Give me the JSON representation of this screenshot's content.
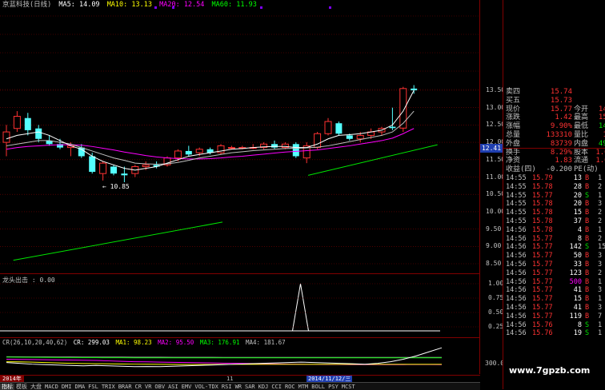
{
  "header": {
    "name": "京蓝科技(日线)",
    "ma5": "MA5: 14.09",
    "ma10": "MA10: 13.13",
    "ma20": "MA20: 12.54",
    "ma60": "MA60: 11.93"
  },
  "colors": {
    "up": "#ff3232",
    "down": "#54ffff",
    "ma5": "#ffffff",
    "ma10": "#ffff00",
    "ma20": "#ff00ff",
    "ma60": "#00ff00",
    "grid": "#800000",
    "green": "#00e600"
  },
  "main_axis": {
    "ticks": [
      "13.50",
      "13.00",
      "12.50",
      "12.00",
      "11.50",
      "11.00",
      "10.50",
      "10.00",
      "9.50",
      "9.00",
      "8.50"
    ],
    "current": "12.41",
    "low_label": "10.85"
  },
  "indicator1": {
    "title": "龙头出击 : 0.00",
    "ticks": [
      "1.00",
      "0.75",
      "0.50",
      "0.25"
    ]
  },
  "indicator2": {
    "title": "CR(26,10,20,40,62)",
    "cr": "CR: 299.03",
    "ma1": "MA1: 98.23",
    "ma2": "MA2: 95.50",
    "ma3": "MA3: 176.91",
    "ma4": "MA4: 181.67",
    "tick": "300.0"
  },
  "timeline": {
    "left": "2014年",
    "mid": "11",
    "date": "2014/11/12/三"
  },
  "tabs": [
    "指标",
    "模板",
    "大盘",
    "MACD",
    "DMI",
    "DMA",
    "FSL",
    "TRIX",
    "BRAR",
    "CR",
    "VR",
    "OBV",
    "ASI",
    "EMV",
    "VOL-TDX",
    "RSI",
    "WR",
    "SAR",
    "KDJ",
    "CCI",
    "ROC",
    "MTM",
    "BOLL",
    "PSY",
    "MCST"
  ],
  "quote": {
    "rows": [
      {
        "label": "卖四",
        "value": "15.74",
        "extra": "",
        "vol": "42"
      },
      {
        "label": "买五",
        "value": "15.73",
        "extra": "",
        "vol": "53"
      },
      {
        "label": "现价",
        "value": "15.77",
        "extra": "今开",
        "vol": "14.34"
      },
      {
        "label": "涨跌",
        "value": "1.42",
        "extra": "最高",
        "vol": "15.79"
      },
      {
        "label": "涨幅",
        "value": "9.90%",
        "extra": "最低",
        "vol": "14.24"
      },
      {
        "label": "总量",
        "value": "133310",
        "extra": "量比",
        "vol": "1.56"
      },
      {
        "label": "外盘",
        "value": "83739",
        "extra": "内盘",
        "vol": "49571"
      },
      {
        "label": "换手",
        "value": "8.29%",
        "extra": "股本",
        "vol": "1.61亿"
      },
      {
        "label": "净资",
        "value": "1.83",
        "extra": "流通",
        "vol": "1.61亿"
      },
      {
        "label": "收益(四)",
        "value": "-0.200",
        "extra": "PE(动)",
        "vol": "-"
      }
    ]
  },
  "trades": [
    {
      "time": "14:55",
      "price": "15.79",
      "vol": "13",
      "bs": "B",
      "n": "1"
    },
    {
      "time": "14:55",
      "price": "15.78",
      "vol": "28",
      "bs": "B",
      "n": "2"
    },
    {
      "time": "14:55",
      "price": "15.77",
      "vol": "20",
      "bs": "S",
      "n": "1"
    },
    {
      "time": "14:55",
      "price": "15.78",
      "vol": "20",
      "bs": "B",
      "n": "3"
    },
    {
      "time": "14:55",
      "price": "15.78",
      "vol": "15",
      "bs": "B",
      "n": "2"
    },
    {
      "time": "14:55",
      "price": "15.78",
      "vol": "37",
      "bs": "B",
      "n": "2"
    },
    {
      "time": "14:56",
      "price": "15.78",
      "vol": "4",
      "bs": "B",
      "n": "1"
    },
    {
      "time": "14:56",
      "price": "15.77",
      "vol": "8",
      "bs": "B",
      "n": "2"
    },
    {
      "time": "14:56",
      "price": "15.77",
      "vol": "142",
      "bs": "S",
      "n": "15"
    },
    {
      "time": "14:56",
      "price": "15.77",
      "vol": "50",
      "bs": "B",
      "n": "3"
    },
    {
      "time": "14:56",
      "price": "15.77",
      "vol": "33",
      "bs": "B",
      "n": "3"
    },
    {
      "time": "14:56",
      "price": "15.77",
      "vol": "123",
      "bs": "B",
      "n": "2"
    },
    {
      "time": "14:56",
      "price": "15.77",
      "vol": "500",
      "bs": "B",
      "n": "1"
    },
    {
      "time": "14:56",
      "price": "15.77",
      "vol": "41",
      "bs": "B",
      "n": "3"
    },
    {
      "time": "14:56",
      "price": "15.77",
      "vol": "15",
      "bs": "B",
      "n": "1"
    },
    {
      "time": "14:56",
      "price": "15.77",
      "vol": "41",
      "bs": "B",
      "n": "3"
    },
    {
      "time": "14:56",
      "price": "15.77",
      "vol": "119",
      "bs": "B",
      "n": "7"
    },
    {
      "time": "14:56",
      "price": "15.76",
      "vol": "8",
      "bs": "S",
      "n": "1"
    },
    {
      "time": "14:56",
      "price": "15.76",
      "vol": "19",
      "bs": "S",
      "n": "1"
    }
  ],
  "watermark": "www.7gpzb.com",
  "chart_data": {
    "type": "candlestick",
    "candles": [
      {
        "o": 12.0,
        "h": 12.5,
        "l": 11.6,
        "c": 12.3
      },
      {
        "o": 12.4,
        "h": 12.9,
        "l": 12.3,
        "c": 12.75
      },
      {
        "o": 12.7,
        "h": 12.85,
        "l": 12.2,
        "c": 12.35
      },
      {
        "o": 12.4,
        "h": 12.5,
        "l": 12.0,
        "c": 12.1
      },
      {
        "o": 12.05,
        "h": 12.2,
        "l": 11.9,
        "c": 11.95
      },
      {
        "o": 11.95,
        "h": 12.1,
        "l": 11.8,
        "c": 11.85
      },
      {
        "o": 11.85,
        "h": 12.0,
        "l": 11.6,
        "c": 11.9
      },
      {
        "o": 11.85,
        "h": 11.95,
        "l": 11.55,
        "c": 11.6
      },
      {
        "o": 11.6,
        "h": 11.7,
        "l": 11.1,
        "c": 11.15
      },
      {
        "o": 11.1,
        "h": 11.45,
        "l": 10.9,
        "c": 11.4
      },
      {
        "o": 11.3,
        "h": 11.35,
        "l": 11.05,
        "c": 11.1
      },
      {
        "o": 11.1,
        "h": 11.3,
        "l": 10.85,
        "c": 11.05
      },
      {
        "o": 11.1,
        "h": 11.35,
        "l": 11.0,
        "c": 11.3
      },
      {
        "o": 11.3,
        "h": 11.45,
        "l": 11.2,
        "c": 11.35
      },
      {
        "o": 11.35,
        "h": 11.45,
        "l": 11.25,
        "c": 11.3
      },
      {
        "o": 11.35,
        "h": 11.6,
        "l": 11.3,
        "c": 11.55
      },
      {
        "o": 11.55,
        "h": 11.8,
        "l": 11.45,
        "c": 11.75
      },
      {
        "o": 11.75,
        "h": 11.9,
        "l": 11.6,
        "c": 11.65
      },
      {
        "o": 11.7,
        "h": 11.85,
        "l": 11.6,
        "c": 11.8
      },
      {
        "o": 11.8,
        "h": 11.85,
        "l": 11.65,
        "c": 11.7
      },
      {
        "o": 11.7,
        "h": 11.95,
        "l": 11.65,
        "c": 11.9
      },
      {
        "o": 11.85,
        "h": 11.9,
        "l": 11.8,
        "c": 11.85
      },
      {
        "o": 11.85,
        "h": 11.9,
        "l": 11.8,
        "c": 11.85
      },
      {
        "o": 11.85,
        "h": 11.95,
        "l": 11.8,
        "c": 11.85
      },
      {
        "o": 11.85,
        "h": 12.0,
        "l": 11.8,
        "c": 11.95
      },
      {
        "o": 11.95,
        "h": 12.05,
        "l": 11.8,
        "c": 11.85
      },
      {
        "o": 11.85,
        "h": 12.0,
        "l": 11.8,
        "c": 11.95
      },
      {
        "o": 11.95,
        "h": 12.0,
        "l": 11.55,
        "c": 11.6
      },
      {
        "o": 11.55,
        "h": 12.0,
        "l": 11.4,
        "c": 11.9
      },
      {
        "o": 11.85,
        "h": 12.3,
        "l": 11.8,
        "c": 12.25
      },
      {
        "o": 12.25,
        "h": 12.7,
        "l": 12.2,
        "c": 12.6
      },
      {
        "o": 12.55,
        "h": 12.6,
        "l": 12.2,
        "c": 12.25
      },
      {
        "o": 12.2,
        "h": 12.25,
        "l": 12.05,
        "c": 12.1
      },
      {
        "o": 12.1,
        "h": 12.3,
        "l": 12.0,
        "c": 12.2
      },
      {
        "o": 12.2,
        "h": 12.4,
        "l": 12.1,
        "c": 12.3
      },
      {
        "o": 12.3,
        "h": 12.45,
        "l": 12.2,
        "c": 12.4
      },
      {
        "o": 12.45,
        "h": 13.0,
        "l": 12.35,
        "c": 12.41
      },
      {
        "o": 12.41,
        "h": 13.6,
        "l": 12.3,
        "c": 13.55
      },
      {
        "o": 13.55,
        "h": 13.65,
        "l": 13.4,
        "c": 13.5
      }
    ],
    "ma5": [
      12.1,
      12.2,
      12.25,
      12.3,
      12.2,
      12.05,
      11.9,
      11.8,
      11.6,
      11.45,
      11.35,
      11.25,
      11.2,
      11.25,
      11.3,
      11.4,
      11.5,
      11.6,
      11.65,
      11.7,
      11.75,
      11.8,
      11.82,
      11.85,
      11.87,
      11.88,
      11.88,
      11.85,
      11.85,
      11.95,
      12.1,
      12.2,
      12.22,
      12.25,
      12.3,
      12.35,
      12.5,
      12.9,
      13.5
    ],
    "ma10": [
      11.9,
      11.95,
      12.0,
      12.05,
      12.05,
      12.0,
      11.95,
      11.85,
      11.75,
      11.65,
      11.55,
      11.48,
      11.4,
      11.38,
      11.37,
      11.38,
      11.42,
      11.48,
      11.55,
      11.6,
      11.65,
      11.7,
      11.73,
      11.76,
      11.78,
      11.8,
      11.82,
      11.83,
      11.84,
      11.86,
      11.9,
      11.96,
      12.02,
      12.08,
      12.14,
      12.2,
      12.3,
      12.55,
      12.9
    ],
    "ma20": [
      11.8,
      11.85,
      11.88,
      11.9,
      11.92,
      11.93,
      11.93,
      11.92,
      11.88,
      11.83,
      11.78,
      11.72,
      11.67,
      11.62,
      11.58,
      11.55,
      11.53,
      11.52,
      11.52,
      11.53,
      11.55,
      11.58,
      11.6,
      11.63,
      11.66,
      11.69,
      11.72,
      11.74,
      11.76,
      11.78,
      11.82,
      11.86,
      11.9,
      11.95,
      12.0,
      12.05,
      12.12,
      12.25,
      12.4
    ],
    "ma60_seg1": [
      [
        1,
        8.6
      ],
      [
        31,
        9.7
      ]
    ],
    "ma60_seg2": [
      [
        42,
        11.05
      ],
      [
        60,
        11.93
      ]
    ],
    "indicator1_values": {
      "spike_index": 35,
      "value": 1.0
    },
    "indicator2": {
      "cr": [
        120,
        110,
        100,
        95,
        90,
        85,
        80,
        85,
        80,
        75,
        70,
        72,
        70,
        75,
        80,
        85,
        90,
        95,
        100,
        105,
        110,
        115,
        120,
        125,
        120,
        115,
        110,
        105,
        100,
        110,
        130,
        160,
        200,
        250,
        299
      ],
      "ma1": [
        130,
        128,
        125,
        120,
        115,
        110,
        108,
        106,
        104,
        102,
        100,
        99,
        98,
        97,
        96,
        96,
        96,
        97,
        98,
        98,
        98,
        98,
        98,
        98,
        98,
        98,
        98,
        98,
        98,
        98,
        98,
        98,
        98,
        98,
        98
      ],
      "ma2": [
        160,
        158,
        156,
        154,
        152,
        150,
        148,
        145,
        140,
        135,
        130,
        128,
        125,
        122,
        120,
        118,
        115,
        112,
        110,
        108,
        105,
        103,
        101,
        99,
        97,
        96,
        96,
        95,
        95,
        95,
        95,
        95,
        96,
        96,
        95
      ],
      "ma3": [
        185,
        184,
        183,
        182,
        181,
        180,
        180,
        179,
        178,
        178,
        177,
        177,
        177,
        177,
        177,
        177,
        177,
        177,
        177,
        177,
        177,
        177,
        177,
        177,
        177,
        177,
        177,
        177,
        177,
        177,
        177,
        177,
        177,
        177,
        177
      ],
      "ma4": [
        190,
        189,
        188,
        188,
        187,
        187,
        186,
        186,
        185,
        185,
        184,
        184,
        184,
        183,
        183,
        183,
        183,
        182,
        182,
        182,
        182,
        182,
        182,
        182,
        182,
        182,
        182,
        182,
        182,
        182,
        182,
        182,
        182,
        182,
        182
      ]
    }
  }
}
